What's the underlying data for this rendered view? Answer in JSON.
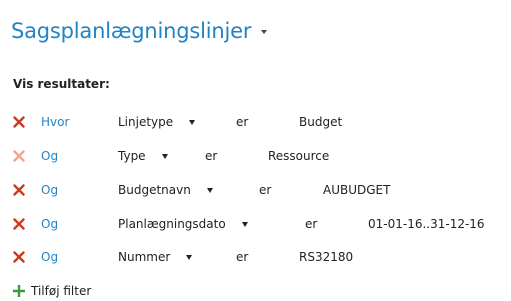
{
  "page": {
    "title": "Sagsplanlægningslinjer"
  },
  "filters": {
    "heading": "Vis resultater:",
    "rows": [
      {
        "conjunction": "Hvor",
        "field": "Linjetype",
        "operator": "er",
        "value": "Budget"
      },
      {
        "conjunction": "Og",
        "field": "Type",
        "operator": "er",
        "value": "Ressource"
      },
      {
        "conjunction": "Og",
        "field": "Budgetnavn",
        "operator": "er",
        "value": "AUBUDGET"
      },
      {
        "conjunction": "Og",
        "field": "Planlægningsdato",
        "operator": "er",
        "value": "01-01-16..31-12-16"
      },
      {
        "conjunction": "Og",
        "field": "Nummer",
        "operator": "er",
        "value": "RS32180"
      }
    ],
    "add_label": "Tilføj filter"
  },
  "colors": {
    "accent_blue": "#1f84c6",
    "remove_red": "#cc3a1c",
    "remove_red_faded": "#f0a68f",
    "add_green": "#3d9a3d"
  },
  "icons": {
    "remove": "close-icon",
    "add": "plus-icon",
    "dropdown": "chevron-down-icon"
  }
}
